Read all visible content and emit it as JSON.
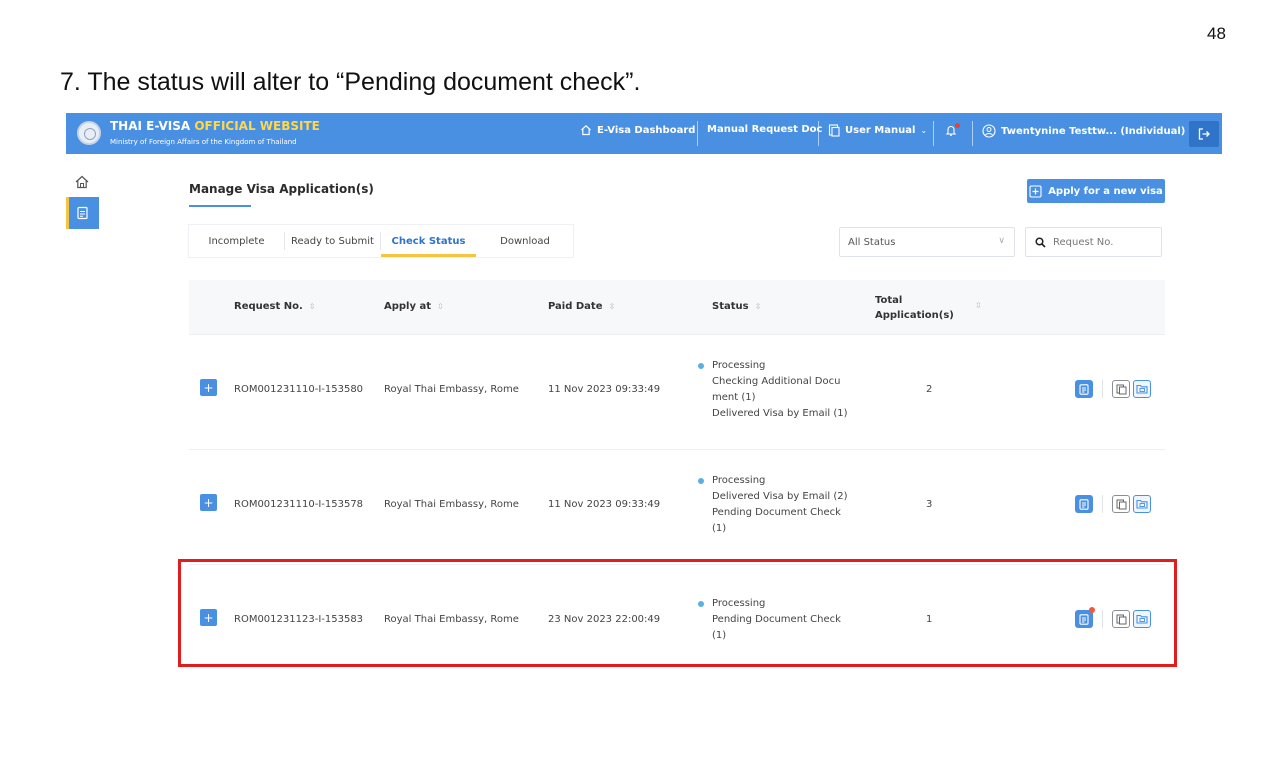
{
  "doc": {
    "page_number": "48",
    "heading": "7. The status will alter to “Pending document check”."
  },
  "header": {
    "brand_part1": "THAI E-VISA",
    "brand_part2": "OFFICIAL WEBSITE",
    "brand_subtitle": "Ministry of Foreign Affairs of the Kingdom of Thailand",
    "nav": {
      "dashboard": "E-Visa Dashboard",
      "manual_request": "Manual Request Doc",
      "user_manual": "User Manual",
      "user": "Twentynine Testtw... (Individual)"
    },
    "colors": {
      "bar": "#4a90e2",
      "brand_accent": "#ffd84a",
      "notification": "#e8413a"
    }
  },
  "main": {
    "title": "Manage Visa Application(s)",
    "apply_button": "Apply for a new visa",
    "tabs": [
      "Incomplete",
      "Ready to Submit",
      "Check Status",
      "Download"
    ],
    "active_tab": "Check Status",
    "status_filter": "All Status",
    "search_placeholder": "Request No."
  },
  "table": {
    "columns": {
      "request_no": "Request No.",
      "apply_at": "Apply at",
      "paid_date": "Paid Date",
      "status": "Status",
      "total_line1": "Total",
      "total_line2": "Application(s)"
    },
    "rows": [
      {
        "request_no": "ROM001231110-I-153580",
        "apply_at": "Royal Thai Embassy, Rome",
        "paid_date": "11 Nov 2023 09:33:49",
        "status": [
          "Processing",
          "Checking Additional Docu",
          "ment (1)",
          "Delivered Visa by Email (1)"
        ],
        "total": "2",
        "has_notification": false
      },
      {
        "request_no": "ROM001231110-I-153578",
        "apply_at": "Royal Thai Embassy, Rome",
        "paid_date": "11 Nov 2023 09:33:49",
        "status": [
          "Processing",
          "Delivered Visa by Email (2)",
          "Pending Document Check",
          "(1)"
        ],
        "total": "3",
        "has_notification": false
      },
      {
        "request_no": "ROM001231123-I-153583",
        "apply_at": "Royal Thai Embassy, Rome",
        "paid_date": "23 Nov 2023 22:00:49",
        "status": [
          "Processing",
          "Pending Document Check",
          "(1)"
        ],
        "total": "1",
        "has_notification": true,
        "highlighted": true
      }
    ]
  },
  "icons": {
    "home": "home-icon",
    "document": "document-icon",
    "bell": "bell-icon",
    "user": "user-icon",
    "logout": "logout-icon",
    "search": "search-icon",
    "plus": "plus-icon",
    "folder": "folder-icon"
  },
  "annotation_color": "#e01e1e"
}
